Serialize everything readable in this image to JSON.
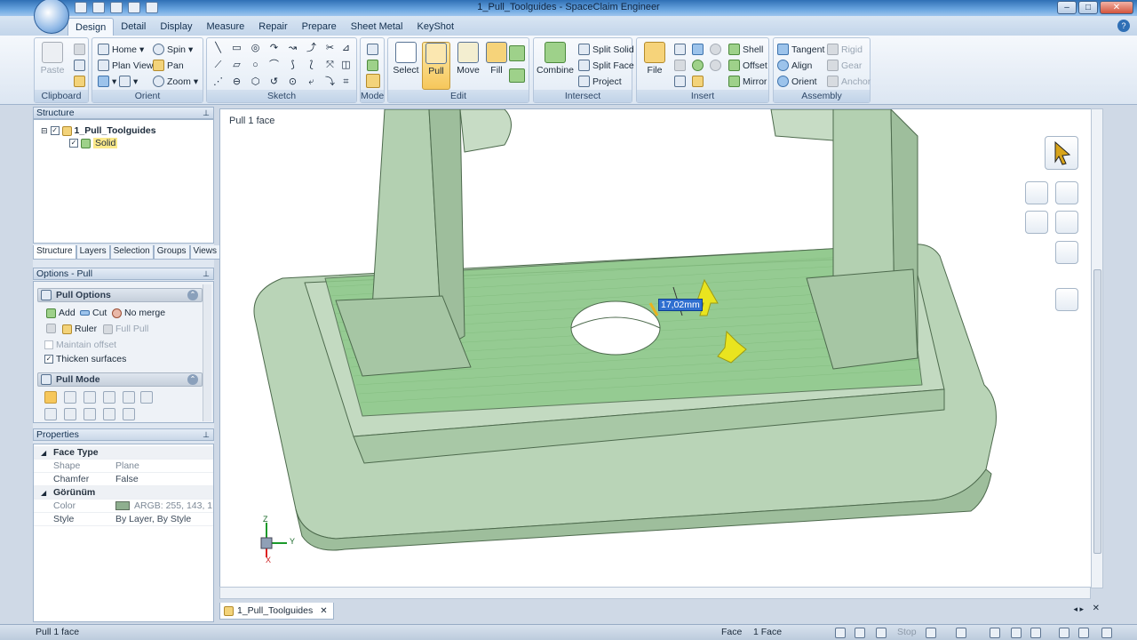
{
  "window": {
    "title": "1_Pull_Toolguides - SpaceClaim Engineer"
  },
  "ribbon_tabs": [
    "Design",
    "Detail",
    "Display",
    "Measure",
    "Repair",
    "Prepare",
    "Sheet Metal",
    "KeyShot"
  ],
  "ribbon": {
    "clipboard": {
      "label": "Clipboard",
      "paste": "Paste"
    },
    "orient": {
      "label": "Orient",
      "home": "Home",
      "spin": "Spin",
      "plan_view": "Plan View",
      "pan": "Pan",
      "zoom": "Zoom"
    },
    "sketch": {
      "label": "Sketch"
    },
    "mode": {
      "label": "Mode"
    },
    "edit": {
      "label": "Edit",
      "select": "Select",
      "pull": "Pull",
      "move": "Move",
      "fill": "Fill"
    },
    "intersect": {
      "label": "Intersect",
      "combine": "Combine",
      "split_solid": "Split Solid",
      "split_face": "Split Face",
      "project": "Project"
    },
    "insert": {
      "label": "Insert",
      "file": "File",
      "shell": "Shell",
      "offset": "Offset",
      "mirror": "Mirror"
    },
    "assembly": {
      "label": "Assembly",
      "tangent": "Tangent",
      "align": "Align",
      "orient": "Orient",
      "rigid": "Rigid",
      "gear": "Gear",
      "anchor": "Anchor"
    }
  },
  "structure": {
    "header": "Structure",
    "root": "1_Pull_Toolguides",
    "child": "Solid",
    "tabs": [
      "Structure",
      "Layers",
      "Selection",
      "Groups",
      "Views"
    ]
  },
  "options": {
    "header": "Options - Pull",
    "pull_options_title": "Pull Options",
    "add": "Add",
    "cut": "Cut",
    "no_merge": "No merge",
    "ruler": "Ruler",
    "full_pull": "Full Pull",
    "maintain_offset": "Maintain offset",
    "thicken_surfaces": "Thicken surfaces",
    "pull_mode_title": "Pull Mode"
  },
  "properties": {
    "header": "Properties",
    "rows": [
      {
        "kind": "cat",
        "key": "Face Type",
        "value": ""
      },
      {
        "kind": "row",
        "key": "Shape",
        "value": "Plane"
      },
      {
        "kind": "row",
        "key": "Chamfer",
        "value": "False"
      },
      {
        "kind": "cat",
        "key": "Görünüm",
        "value": ""
      },
      {
        "kind": "row",
        "key": "Color",
        "value": "ARGB: 255, 143, 1"
      },
      {
        "kind": "row",
        "key": "Style",
        "value": "By Layer, By Style"
      }
    ]
  },
  "viewport": {
    "caption": "Pull 1 face",
    "dimension": "17,02mm",
    "axis": {
      "z": "Z",
      "y": "Y",
      "x": "X"
    }
  },
  "document_tab": "1_Pull_Toolguides",
  "status": {
    "left": "Pull 1 face",
    "selection_type": "Face",
    "selection_count": "1 Face",
    "stop": "Stop"
  },
  "colors": {
    "model_face": "#b5d1b3",
    "model_edge": "#4d6a4d",
    "selected_face": "#8ec98a",
    "pull_arrow": "#e9e41f",
    "dimension_bg": "#2f6fd0"
  }
}
